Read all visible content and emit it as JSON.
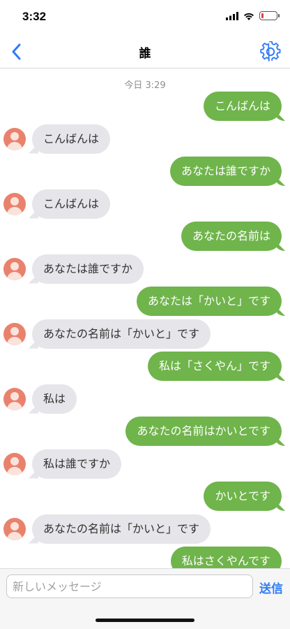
{
  "status_bar": {
    "time": "3:32",
    "battery_color": "#e0403a"
  },
  "nav": {
    "title": "誰"
  },
  "chat": {
    "date_label": "今日 3:29",
    "messages": [
      {
        "side": "out",
        "text": "こんばんは"
      },
      {
        "side": "in",
        "text": "こんばんは"
      },
      {
        "side": "out",
        "text": "あなたは誰ですか"
      },
      {
        "side": "in",
        "text": "こんばんは"
      },
      {
        "side": "out",
        "text": "あなたの名前は"
      },
      {
        "side": "in",
        "text": "あなたは誰ですか"
      },
      {
        "side": "out",
        "text": "あなたは「かいと」です"
      },
      {
        "side": "in",
        "text": "あなたの名前は「かいと」です"
      },
      {
        "side": "out",
        "text": "私は「さくやん」です"
      },
      {
        "side": "in",
        "text": "私は"
      },
      {
        "side": "out",
        "text": "あなたの名前はかいとです"
      },
      {
        "side": "in",
        "text": "私は誰ですか"
      },
      {
        "side": "out",
        "text": "かいとです"
      },
      {
        "side": "in",
        "text": "あなたの名前は「かいと」です"
      },
      {
        "side": "out",
        "text": "私はさくやんです"
      }
    ]
  },
  "input": {
    "placeholder": "新しいメッセージ",
    "value": ""
  },
  "send_label": "送信",
  "colors": {
    "accent": "#2f7cf6",
    "outgoing_bubble": "#70b44c",
    "incoming_bubble": "#e5e5ea",
    "avatar": "#e9826d"
  },
  "icons": {
    "back": "chevron-left-icon",
    "settings": "gear-icon",
    "avatar": "person-icon"
  }
}
